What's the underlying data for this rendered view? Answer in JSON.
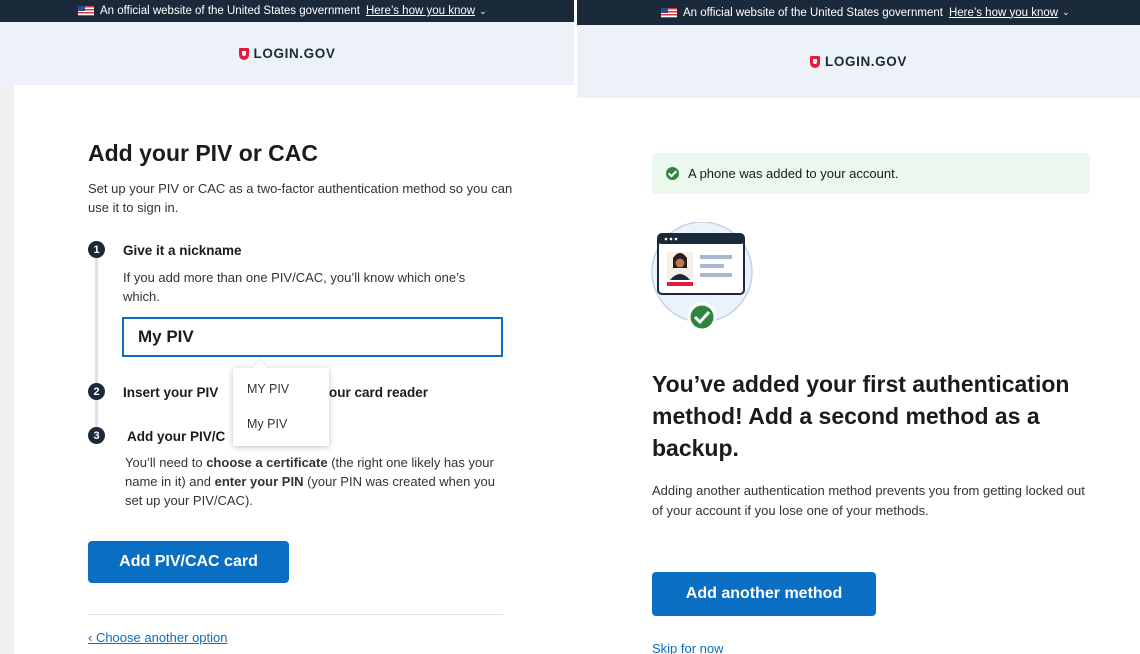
{
  "left": {
    "banner": {
      "text": "An official website of the United States government",
      "link": "Here’s how you know"
    },
    "logo": "LOGIN.GOV",
    "title": "Add your PIV or CAC",
    "intro": "Set up your PIV or CAC as a two-factor authentication method so you can use it to sign in.",
    "steps": [
      {
        "num": "1",
        "title": "Give it a nickname",
        "text": "If you add more than one PIV/CAC, you’ll know which one’s which."
      },
      {
        "num": "2",
        "title_a": "Insert your PIV",
        "title_b": "our card reader"
      },
      {
        "num": "3",
        "title": "Add your PIV/C",
        "text_parts": [
          "You’ll need to ",
          "choose a certificate",
          " (the right one likely has your name in it) and ",
          "enter your PIN",
          " (your PIN was created when you set up your PIV/CAC)."
        ]
      }
    ],
    "nickname_value": "My PIV",
    "autocomplete": [
      "MY PIV",
      "My PIV"
    ],
    "add_button": "Add PIV/CAC card",
    "choose_other": "‹ Choose another option"
  },
  "right": {
    "banner": {
      "text": "An official website of the United States government",
      "link": "Here’s how you know"
    },
    "logo": "LOGIN.GOV",
    "alert": "A phone was added to your account.",
    "heading": "You’ve added your first authentication method! Add a second method as a backup.",
    "description": "Adding another authentication method prevents you from getting locked out of your account if you lose one of your methods.",
    "add_button": "Add another method",
    "skip": "Skip for now"
  },
  "colors": {
    "banner": "#1b2a3b",
    "header": "#edf2f8",
    "primary": "#0a6fc2",
    "success": "#2e8540",
    "alert_bg": "#ecf7ed",
    "brand_red": "#e21c3d"
  },
  "icons": [
    "us-flag-icon",
    "chevron-down-icon",
    "login-shield-icon",
    "check-circle-icon",
    "id-card-illustration"
  ]
}
